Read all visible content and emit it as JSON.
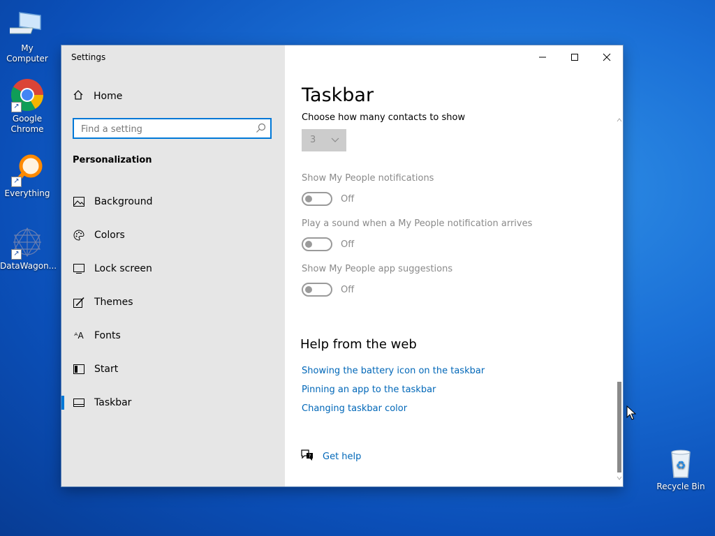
{
  "desktop": {
    "icons": [
      {
        "label": "My Computer"
      },
      {
        "label": "Google Chrome"
      },
      {
        "label": "Everything"
      },
      {
        "label": "DataWagon..."
      },
      {
        "label": "Recycle Bin"
      }
    ]
  },
  "window": {
    "title": "Settings",
    "controls": {
      "minimize": "minimize-icon",
      "maximize": "maximize-icon",
      "close": "close-icon"
    }
  },
  "sidebar": {
    "home_label": "Home",
    "search_placeholder": "Find a setting",
    "section_title": "Personalization",
    "items": [
      {
        "label": "Background",
        "icon": "picture-icon"
      },
      {
        "label": "Colors",
        "icon": "palette-icon"
      },
      {
        "label": "Lock screen",
        "icon": "lock-screen-icon"
      },
      {
        "label": "Themes",
        "icon": "themes-icon"
      },
      {
        "label": "Fonts",
        "icon": "fonts-icon"
      },
      {
        "label": "Start",
        "icon": "start-icon"
      },
      {
        "label": "Taskbar",
        "icon": "taskbar-icon"
      }
    ],
    "active_index": 6
  },
  "main": {
    "title": "Taskbar",
    "contacts_label": "Choose how many contacts to show",
    "contacts_value": "3",
    "settings": [
      {
        "label": "Show My People notifications",
        "state": "Off"
      },
      {
        "label": "Play a sound when a My People notification arrives",
        "state": "Off"
      },
      {
        "label": "Show My People app suggestions",
        "state": "Off"
      }
    ],
    "help_title": "Help from the web",
    "links": [
      "Showing the battery icon on the taskbar",
      "Pinning an app to the taskbar",
      "Changing taskbar color"
    ],
    "get_help": "Get help"
  },
  "colors": {
    "accent": "#0078d7",
    "link": "#0067b8",
    "sidebar_bg": "#e6e6e6"
  }
}
